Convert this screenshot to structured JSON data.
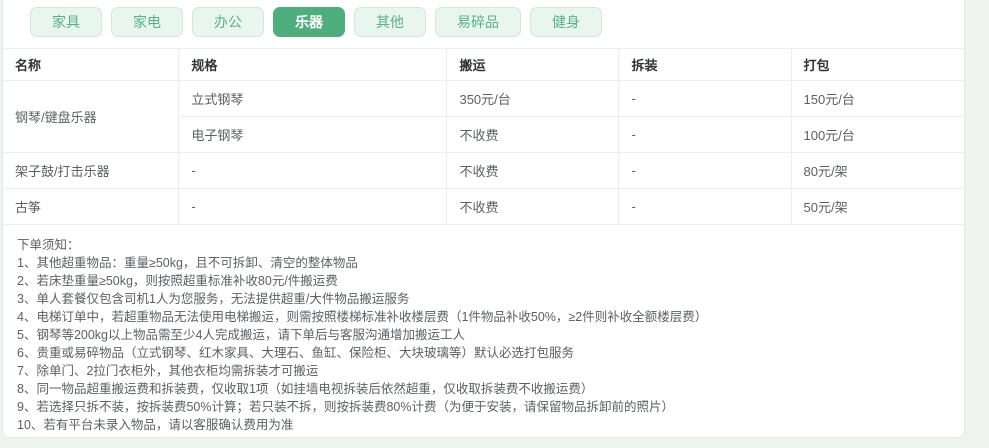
{
  "colors": {
    "accent_green": "#4fae7e",
    "tab_inactive_bg": "#e9f6ef",
    "tab_inactive_text": "#55b286",
    "table_border": "#e7f0ea",
    "body_text": "#5b5f66",
    "header_text": "#30343a"
  },
  "tabs": [
    {
      "label": "家具",
      "active": false
    },
    {
      "label": "家电",
      "active": false
    },
    {
      "label": "办公",
      "active": false
    },
    {
      "label": "乐器",
      "active": true
    },
    {
      "label": "其他",
      "active": false
    },
    {
      "label": "易碎品",
      "active": false
    },
    {
      "label": "健身",
      "active": false
    }
  ],
  "table": {
    "headers": [
      "名称",
      "规格",
      "搬运",
      "拆装",
      "打包"
    ],
    "rows": [
      {
        "name": "钢琴/键盘乐器",
        "spec": "立式钢琴",
        "moving": "350元/台",
        "disassembly": "-",
        "packing": "150元/台"
      },
      {
        "spec": "电子钢琴",
        "moving": "不收费",
        "disassembly": "-",
        "packing": "100元/台"
      },
      {
        "name": "架子鼓/打击乐器",
        "spec": "-",
        "moving": "不收费",
        "disassembly": "-",
        "packing": "80元/架"
      },
      {
        "name": "古筝",
        "spec": "-",
        "moving": "不收费",
        "disassembly": "-",
        "packing": "50元/架"
      }
    ]
  },
  "notes": {
    "title": "下单须知：",
    "items": [
      "1、其他超重物品：重量≥50kg，且不可拆卸、清空的整体物品",
      "2、若床垫重量≥50kg，则按照超重标准补收80元/件搬运费",
      "3、单人套餐仅包含司机1人为您服务，无法提供超重/大件物品搬运服务",
      "4、电梯订单中，若超重物品无法使用电梯搬运，则需按照楼梯标准补收楼层费（1件物品补收50%，≥2件则补收全额楼层费）",
      "5、钢琴等200kg以上物品需至少4人完成搬运，请下单后与客服沟通增加搬运工人",
      "6、贵重或易碎物品（立式钢琴、红木家具、大理石、鱼缸、保险柜、大块玻璃等）默认必选打包服务",
      "7、除单门、2拉门衣柜外，其他衣柜均需拆装才可搬运",
      "8、同一物品超重搬运费和拆装费，仅收取1项（如挂墙电视拆装后依然超重，仅收取拆装费不收搬运费）",
      "9、若选择只拆不装，按拆装费50%计算；若只装不拆，则按拆装费80%计费（为便于安装，请保留物品拆卸前的照片）",
      "10、若有平台未录入物品，请以客服确认费用为准"
    ]
  }
}
